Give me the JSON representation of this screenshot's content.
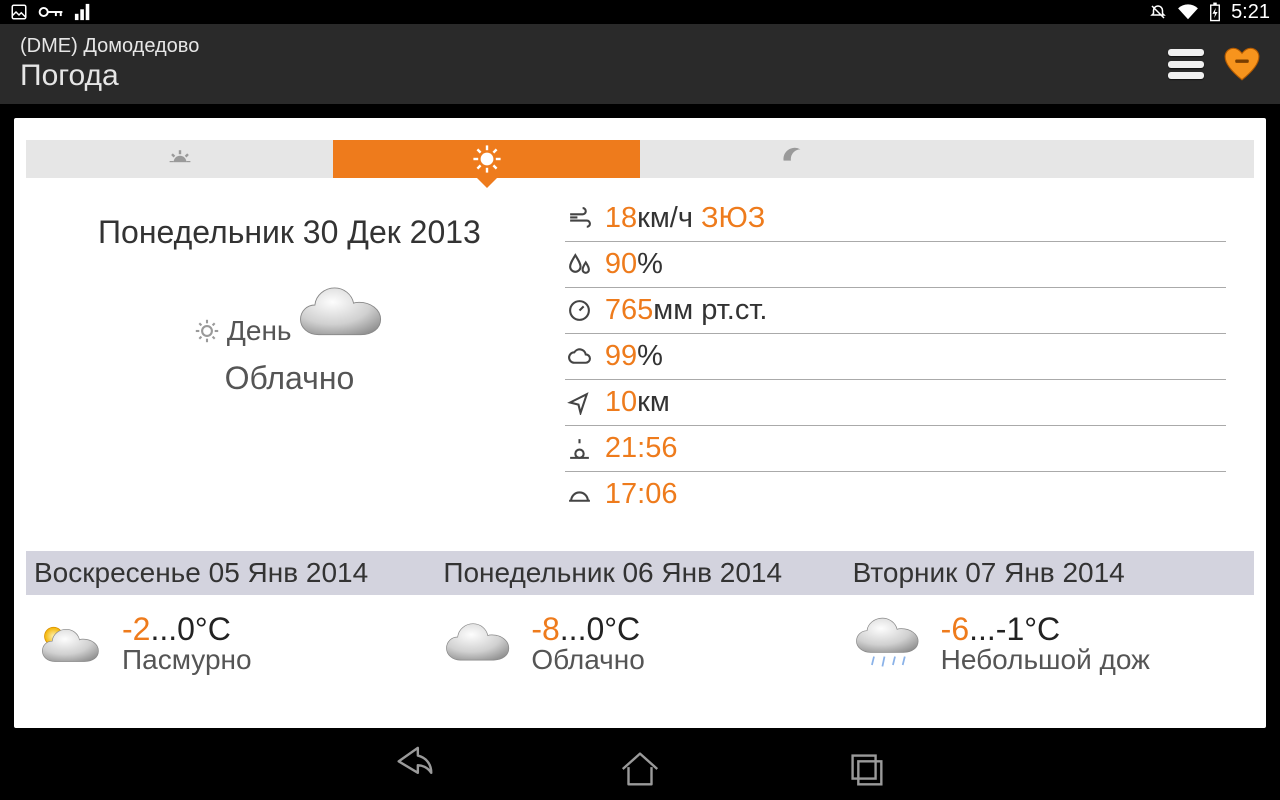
{
  "status": {
    "time": "5:21"
  },
  "header": {
    "subtitle": "(DME) Домодедово",
    "title": "Погода"
  },
  "current": {
    "date": "Понедельник 30 Дек 2013",
    "period_label": "День",
    "condition": "Облачно"
  },
  "metrics": {
    "wind": {
      "value": "18",
      "unit": " км/ч ",
      "direction": "ЗЮЗ"
    },
    "humidity": {
      "value": "90",
      "unit": "%"
    },
    "pressure": {
      "value": "765",
      "unit": " мм рт.ст."
    },
    "cloud_cover": {
      "value": "99",
      "unit": "%"
    },
    "visibility": {
      "value": "10",
      "unit": " км"
    },
    "sunrise": {
      "value": "21:56"
    },
    "sunset": {
      "value": "17:06"
    }
  },
  "forecast": {
    "items": [
      {
        "date": "Воскресенье 05 Янв 2014",
        "temp_low": "-2",
        "temp_high": "...0",
        "temp_unit": "°C",
        "desc": "Пасмурно"
      },
      {
        "date": "Понедельник 06 Янв 2014",
        "temp_low": "-8",
        "temp_high": "...0",
        "temp_unit": "°C",
        "desc": "Облачно"
      },
      {
        "date": "Вторник 07 Янв 2014",
        "temp_low": "-6",
        "temp_high": "...-1",
        "temp_unit": "°C",
        "desc": "Небольшой дож"
      }
    ]
  }
}
